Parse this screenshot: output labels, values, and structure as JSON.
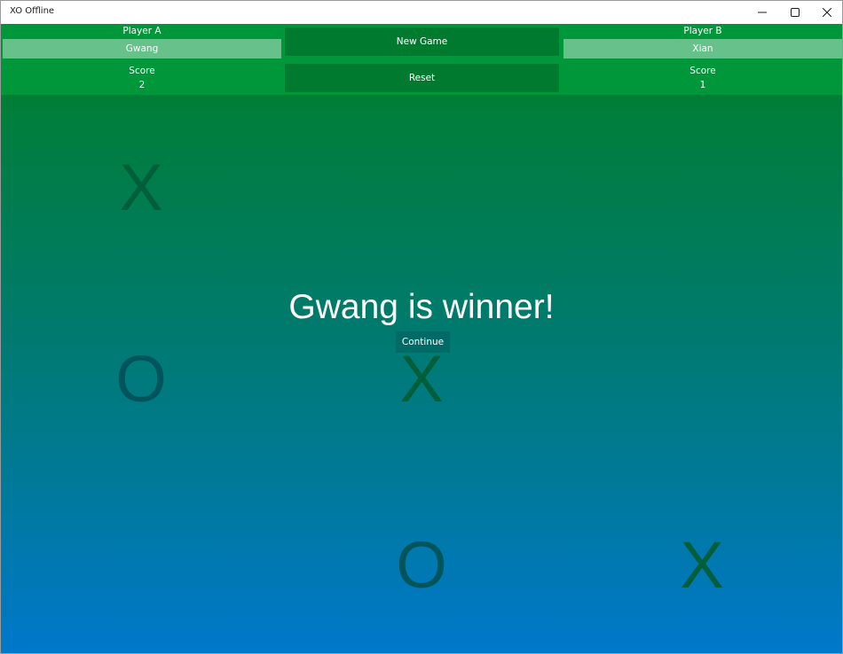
{
  "window": {
    "title": "XO Offline"
  },
  "player_a": {
    "label": "Player A",
    "name": "Gwang",
    "score_label": "Score",
    "score": "2"
  },
  "player_b": {
    "label": "Player B",
    "name": "Xian",
    "score_label": "Score",
    "score": "1"
  },
  "actions": {
    "new_game": "New Game",
    "reset": "Reset"
  },
  "board": {
    "cells": [
      "X",
      "",
      "",
      "O",
      "X",
      "",
      "",
      "O",
      "X"
    ],
    "mark_colors": {
      "X": "#005e3a",
      "O": "#00555c"
    }
  },
  "overlay": {
    "message": "Gwang is winner!",
    "continue_label": "Continue"
  },
  "colors": {
    "header": "#00963a",
    "name_box": "#66c18a",
    "button": "#007a2e",
    "gradient_top": "#007e36",
    "gradient_bottom": "#0078cc"
  }
}
